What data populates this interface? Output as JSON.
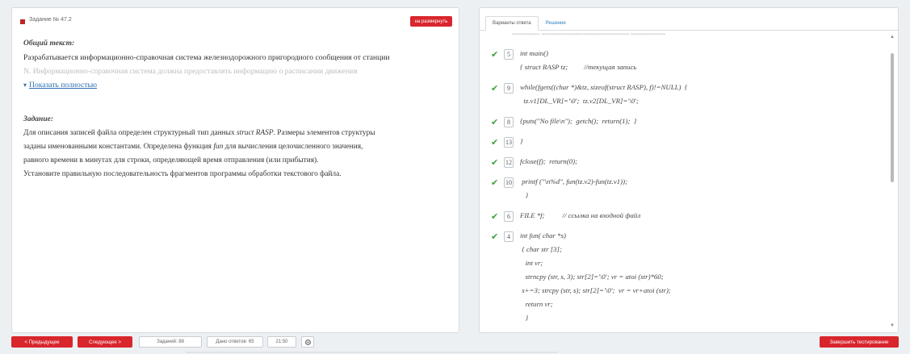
{
  "left_panel": {
    "task_label": "Задание № 47.2",
    "expand_button": "на размернуть",
    "general_title": "Общий текст:",
    "general_line1": "Разрабатывается информационно-справочная система железнодорожного пригородного сообщения от станции",
    "general_line2": "N. Информационно-справочная система должна предоставлять информацию о расписании движения",
    "show_full": "Показать полностью",
    "task_title": "Задание:",
    "task_line1_a": "Для описания записей файла определен структурный тип данных ",
    "task_line1_em": "struct RASP",
    "task_line1_b": ". Размеры элементов структуры",
    "task_line2": "заданы именованными константами. Определена функция ",
    "task_line2_em": "fun",
    "task_line2_b": " для вычисления целочисленного значения,",
    "task_line3": "равного времени в минутах для строки, определяющей время отправления (или прибытия).",
    "task_line4": "Установите правильную последовательность фрагментов программы обработки текстового файла."
  },
  "right_panel": {
    "tabs": [
      {
        "label": "Варианты ответа"
      },
      {
        "label": "Решение"
      }
    ],
    "partial_line": "~~~~~~~~ ~~~~~~~~~~~~~~~~~~~~~~~~~ ~~~~~~~~~~",
    "items": [
      {
        "num": "5",
        "lines": [
          "int main()",
          "{ struct RASP tz;         //текущая запись"
        ]
      },
      {
        "num": "9",
        "lines": [
          "while(fgets((char *)&tz, sizeof(struct RASP), f)!=NULL)  {",
          "  tz.v1[DL_VR]='\\0';  tz.v2[DL_VR]='\\0';"
        ]
      },
      {
        "num": "8",
        "lines": [
          "{puts(\"No file\\n\");  getch();  return(1);  }"
        ]
      },
      {
        "num": "13",
        "lines": [
          "}"
        ]
      },
      {
        "num": "12",
        "lines": [
          "fclose(f);  return(0);"
        ]
      },
      {
        "num": "10",
        "lines": [
          " printf (\"\\n%d\", fun(tz.v2)-fun(tz.v1));",
          "   }"
        ]
      },
      {
        "num": "6",
        "lines": [
          "FILE *f;          // ссылка на входной файл"
        ]
      },
      {
        "num": "4",
        "lines": [
          "int fun( char *s)",
          " { char str [3];",
          "   int vr;",
          "   strncpy (str, s, 3); str[2]='\\0'; vr = atoi (str)*60;",
          " s+=3; strcpy (str, s); str[2]='\\0';  vr = vr+atoi (str);",
          "   return vr;",
          "   }"
        ]
      }
    ]
  },
  "bottom_bar": {
    "prev_button": "< Предыдущее",
    "next_button": "Следующее >",
    "tasks_label": "Заданий: 88",
    "answered_label": "Дано ответов: 65",
    "time_label": "21:50",
    "finish_button": "Завершить тестирование"
  },
  "colors": {
    "accent_red": "#d9262d",
    "check_green": "#3aa13d",
    "link_blue": "#2a6fb0"
  }
}
